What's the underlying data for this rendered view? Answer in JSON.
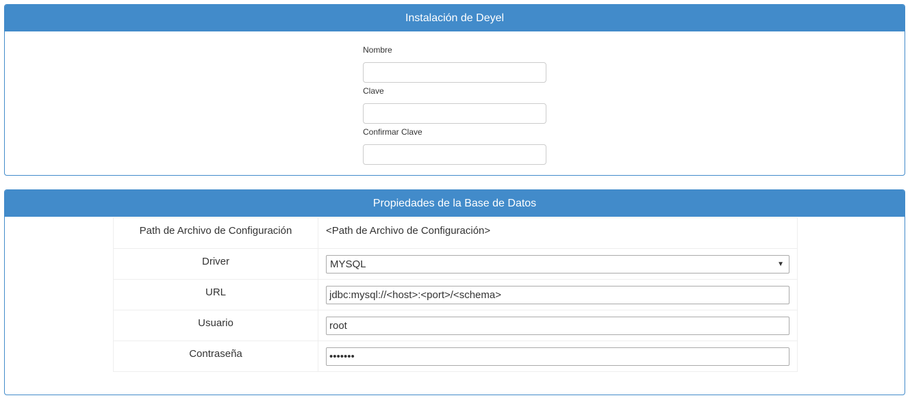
{
  "install_panel": {
    "title": "Instalación de Deyel",
    "fields": [
      {
        "label": "Nombre",
        "value": ""
      },
      {
        "label": "Clave",
        "value": ""
      },
      {
        "label": "Confirmar Clave",
        "value": ""
      }
    ]
  },
  "db_panel": {
    "title": "Propiedades de la Base de Datos",
    "rows": {
      "config_path": {
        "label": "Path de Archivo de Configuración",
        "value": "<Path de Archivo de Configuración>"
      },
      "driver": {
        "label": "Driver",
        "value": "MYSQL"
      },
      "url": {
        "label": "URL",
        "value": "jdbc:mysql://<host>:<port>/<schema>"
      },
      "user": {
        "label": "Usuario",
        "value": "root"
      },
      "password": {
        "label": "Contraseña",
        "value": "•••••••"
      }
    }
  },
  "icons": {
    "dropdown": "chevron-down-icon"
  },
  "colors": {
    "primary": "#428bca",
    "border_light": "#eeeeee"
  }
}
